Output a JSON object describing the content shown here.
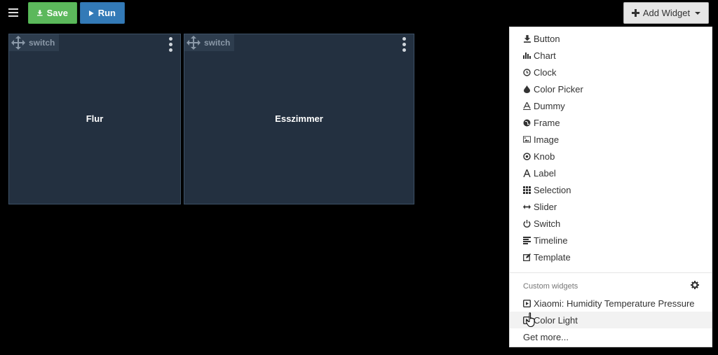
{
  "toolbar": {
    "save_label": "Save",
    "run_label": "Run",
    "add_widget_label": "Add Widget"
  },
  "widgets": [
    {
      "type": "switch",
      "label": "Flur"
    },
    {
      "type": "switch",
      "label": "Esszimmer"
    }
  ],
  "menu": {
    "items": [
      {
        "label": "Button",
        "icon": "download-icon"
      },
      {
        "label": "Chart",
        "icon": "bar-chart-icon"
      },
      {
        "label": "Clock",
        "icon": "clock-icon"
      },
      {
        "label": "Color Picker",
        "icon": "drop-icon"
      },
      {
        "label": "Dummy",
        "icon": "text-underline-icon"
      },
      {
        "label": "Frame",
        "icon": "globe-icon"
      },
      {
        "label": "Image",
        "icon": "image-icon"
      },
      {
        "label": "Knob",
        "icon": "knob-icon"
      },
      {
        "label": "Label",
        "icon": "letter-icon"
      },
      {
        "label": "Selection",
        "icon": "grid-icon"
      },
      {
        "label": "Slider",
        "icon": "resize-horizontal-icon"
      },
      {
        "label": "Switch",
        "icon": "power-icon"
      },
      {
        "label": "Timeline",
        "icon": "timeline-icon"
      },
      {
        "label": "Template",
        "icon": "edit-icon"
      }
    ],
    "custom_header": "Custom widgets",
    "custom_items": [
      {
        "label": "Xiaomi: Humidity Temperature Pressure",
        "icon": "play-box-icon"
      },
      {
        "label": "Color Light",
        "icon": "play-box-icon"
      }
    ],
    "get_more_label": "Get more..."
  },
  "colors": {
    "save": "#5cb85c",
    "run": "#337ab7",
    "widget_bg": "#233040"
  }
}
